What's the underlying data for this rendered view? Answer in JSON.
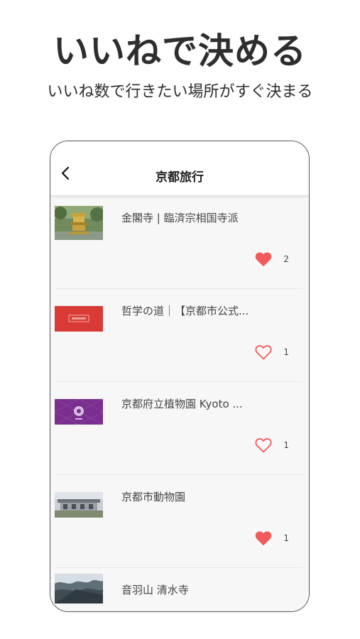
{
  "promo": {
    "headline": "いいねで決める",
    "subline": "いいね数で行きたい場所がすぐ決まる"
  },
  "nav": {
    "back_icon": "chevron-left-icon",
    "title": "京都旅行"
  },
  "colors": {
    "heart": "#f25b5b",
    "list_bg": "#f7f7f7"
  },
  "places": [
    {
      "title": "金閣寺 | 臨済宗相国寺派",
      "likes": "2",
      "liked": true
    },
    {
      "title": "哲学の道｜【京都市公式...",
      "likes": "1",
      "liked": false
    },
    {
      "title": "京都府立植物園 Kyoto ...",
      "likes": "1",
      "liked": false
    },
    {
      "title": "京都市動物園",
      "likes": "1",
      "liked": true
    },
    {
      "title": "音羽山 清水寺",
      "likes": "",
      "liked": false
    }
  ]
}
